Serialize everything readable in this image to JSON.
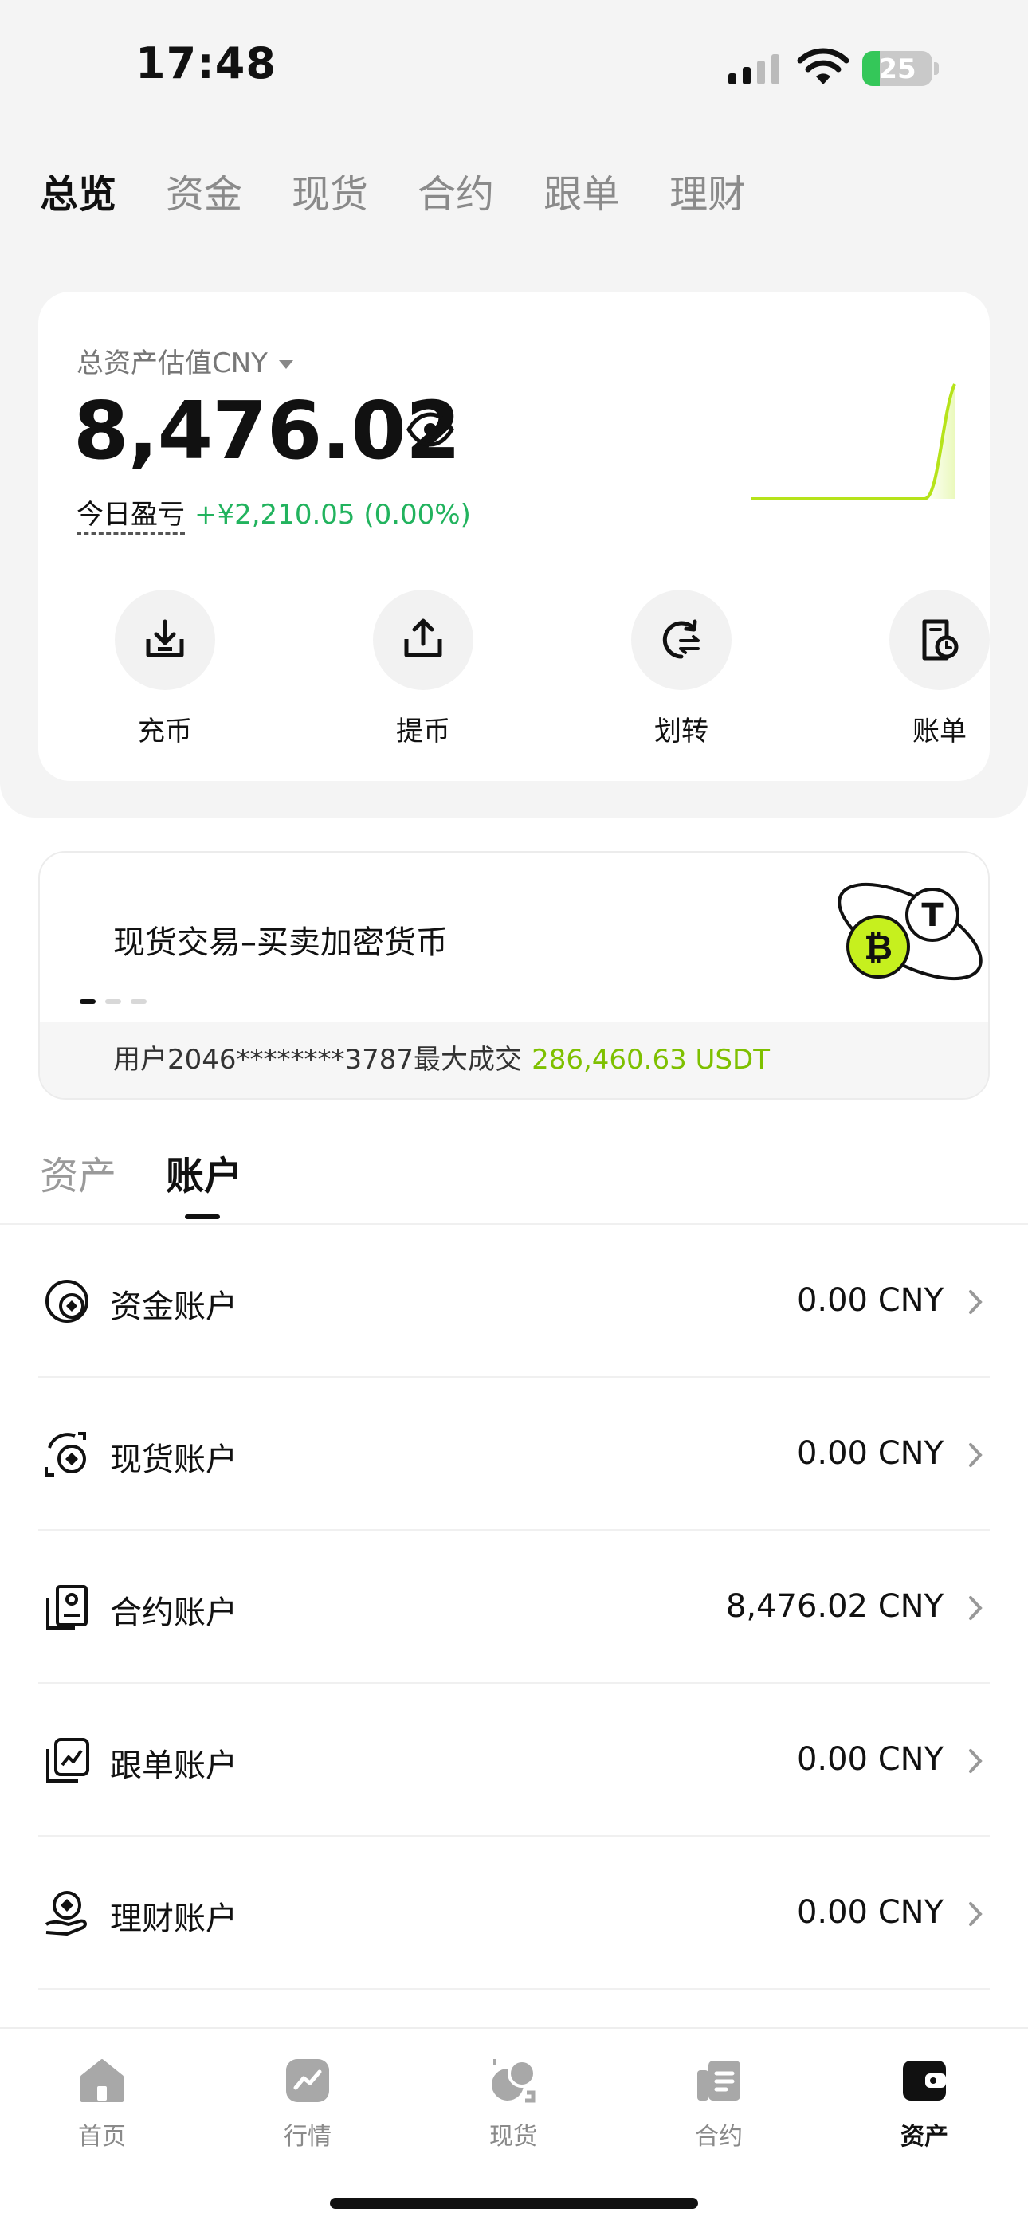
{
  "status_bar": {
    "time": "17:48",
    "battery": "25",
    "battery_level": 0.25
  },
  "top_tabs": [
    {
      "label": "总览",
      "active": true
    },
    {
      "label": "资金",
      "active": false
    },
    {
      "label": "现货",
      "active": false
    },
    {
      "label": "合约",
      "active": false
    },
    {
      "label": "跟单",
      "active": false
    },
    {
      "label": "理财",
      "active": false
    }
  ],
  "asset_card": {
    "estimate_label": "总资产估值CNY",
    "total_value": "8,476.02",
    "pnl_label": "今日盈亏",
    "pnl_value": "+¥2,210.05 (0.00%)",
    "accent_color": "#22b35e",
    "actions": [
      {
        "label": "充币",
        "icon": "deposit-icon"
      },
      {
        "label": "提币",
        "icon": "withdraw-icon"
      },
      {
        "label": "划转",
        "icon": "transfer-icon"
      },
      {
        "label": "账单",
        "icon": "bill-icon"
      }
    ]
  },
  "banner": {
    "title": "现货交易–买卖加密货币",
    "footer_text": "用户2046********3787最大成交",
    "footer_amount": "286,460.63 USDT",
    "amount_color": "#7ec000"
  },
  "section_tabs": [
    {
      "label": "资产",
      "active": false
    },
    {
      "label": "账户",
      "active": true
    }
  ],
  "accounts": [
    {
      "name": "资金账户",
      "value": "0.00 CNY",
      "icon": "funding-account-icon"
    },
    {
      "name": "现货账户",
      "value": "0.00 CNY",
      "icon": "spot-account-icon"
    },
    {
      "name": "合约账户",
      "value": "8,476.02 CNY",
      "icon": "futures-account-icon"
    },
    {
      "name": "跟单账户",
      "value": "0.00 CNY",
      "icon": "copy-trading-account-icon"
    },
    {
      "name": "理财账户",
      "value": "0.00 CNY",
      "icon": "earn-account-icon"
    }
  ],
  "bottom_nav": [
    {
      "label": "首页",
      "icon": "home-icon",
      "active": false
    },
    {
      "label": "行情",
      "icon": "market-icon",
      "active": false
    },
    {
      "label": "现货",
      "icon": "spot-icon",
      "active": false
    },
    {
      "label": "合约",
      "icon": "futures-icon",
      "active": false
    },
    {
      "label": "资产",
      "icon": "wallet-icon",
      "active": true
    }
  ]
}
